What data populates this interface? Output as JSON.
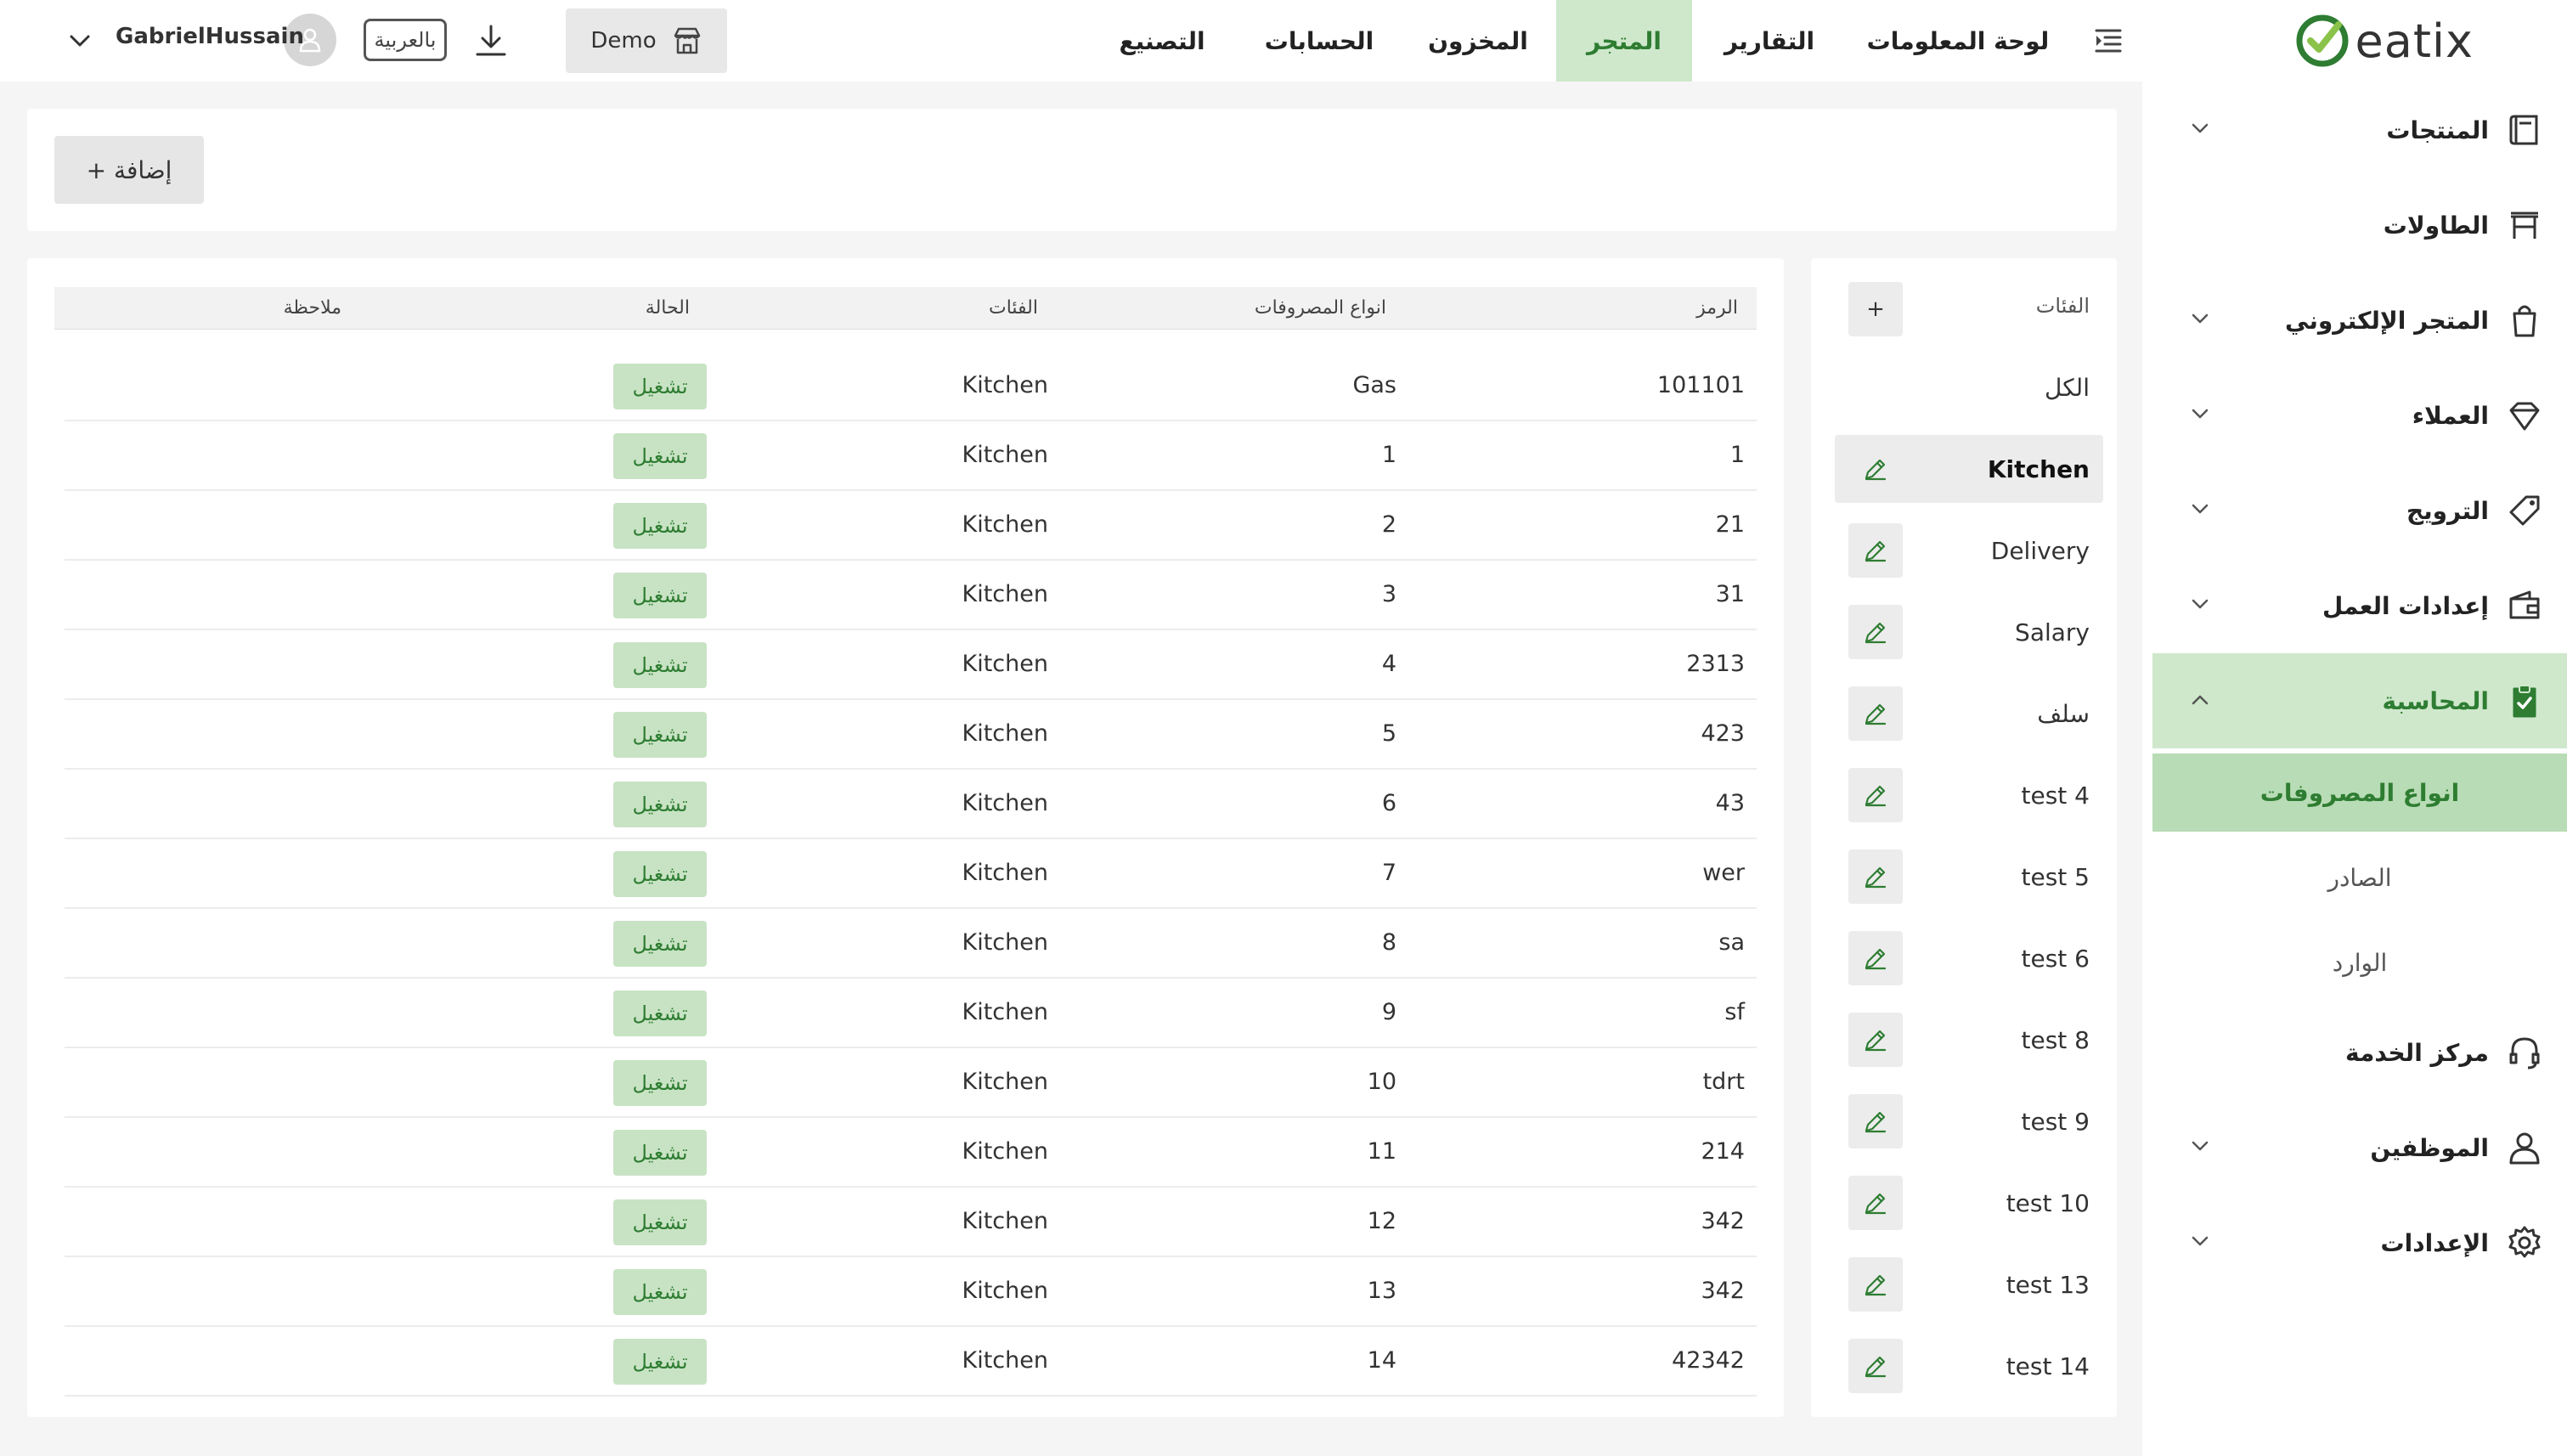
{
  "brand": {
    "name": "eatix",
    "accent": "#2e7d32",
    "accent_light": "#cfe8cc"
  },
  "topbar": {
    "tabs": [
      {
        "label": "لوحة المعلومات"
      },
      {
        "label": "التقارير"
      },
      {
        "label": "المتجر",
        "active": true
      },
      {
        "label": "المخزون"
      },
      {
        "label": "الحسابات"
      },
      {
        "label": "التصنيع"
      }
    ],
    "store_label": "Demo",
    "language_label": "بالعربية",
    "user_name": "GabrielHussain"
  },
  "sidebar": {
    "items": [
      {
        "label": "المنتجات",
        "icon": "book-icon",
        "chevron": "down"
      },
      {
        "label": "الطاولات",
        "icon": "table-icon",
        "chevron": ""
      },
      {
        "label": "المتجر الإلكتروني",
        "icon": "shopping-bag-icon",
        "chevron": "down"
      },
      {
        "label": "العملاء",
        "icon": "diamond-icon",
        "chevron": "down"
      },
      {
        "label": "الترويج",
        "icon": "tag-icon",
        "chevron": "down"
      },
      {
        "label": "إعدادات العمل",
        "icon": "wallet-icon",
        "chevron": "down"
      },
      {
        "label": "المحاسبة",
        "icon": "clipboard-check-icon",
        "chevron": "up",
        "active": true
      },
      {
        "label": "مركز الخدمة",
        "icon": "headset-icon",
        "chevron": ""
      },
      {
        "label": "الموظفين",
        "icon": "user-icon",
        "chevron": "down"
      },
      {
        "label": "الإعدادات",
        "icon": "gear-icon",
        "chevron": "down"
      }
    ],
    "subitems": [
      {
        "label": "انواع المصروفات",
        "active": true
      },
      {
        "label": "الصادر"
      },
      {
        "label": "الوارد"
      }
    ]
  },
  "actions": {
    "add_label": "+ إضافة"
  },
  "categories": {
    "header": "الفئات",
    "add_label": "+",
    "items": [
      {
        "name": "الكل",
        "editable": false
      },
      {
        "name": "Kitchen",
        "editable": true,
        "active": true
      },
      {
        "name": "Delivery",
        "editable": true
      },
      {
        "name": "Salary",
        "editable": true
      },
      {
        "name": "سلف",
        "editable": true
      },
      {
        "name": "test 4",
        "editable": true
      },
      {
        "name": "test 5",
        "editable": true
      },
      {
        "name": "test 6",
        "editable": true
      },
      {
        "name": "test 8",
        "editable": true
      },
      {
        "name": "test 9",
        "editable": true
      },
      {
        "name": "test 10",
        "editable": true
      },
      {
        "name": "test 13",
        "editable": true
      },
      {
        "name": "test 14",
        "editable": true
      }
    ]
  },
  "table": {
    "columns": {
      "code": "الرمز",
      "type": "انواع المصروفات",
      "category": "الفئات",
      "status": "الحالة",
      "note": "ملاحظة"
    },
    "rows": [
      {
        "code": "101101",
        "type": "Gas",
        "category": "Kitchen",
        "status": "تشغيل",
        "note": ""
      },
      {
        "code": "1",
        "type": "1",
        "category": "Kitchen",
        "status": "تشغيل",
        "note": ""
      },
      {
        "code": "21",
        "type": "2",
        "category": "Kitchen",
        "status": "تشغيل",
        "note": ""
      },
      {
        "code": "31",
        "type": "3",
        "category": "Kitchen",
        "status": "تشغيل",
        "note": ""
      },
      {
        "code": "2313",
        "type": "4",
        "category": "Kitchen",
        "status": "تشغيل",
        "note": ""
      },
      {
        "code": "423",
        "type": "5",
        "category": "Kitchen",
        "status": "تشغيل",
        "note": ""
      },
      {
        "code": "43",
        "type": "6",
        "category": "Kitchen",
        "status": "تشغيل",
        "note": ""
      },
      {
        "code": "wer",
        "type": "7",
        "category": "Kitchen",
        "status": "تشغيل",
        "note": ""
      },
      {
        "code": "sa",
        "type": "8",
        "category": "Kitchen",
        "status": "تشغيل",
        "note": ""
      },
      {
        "code": "sf",
        "type": "9",
        "category": "Kitchen",
        "status": "تشغيل",
        "note": ""
      },
      {
        "code": "tdrt",
        "type": "10",
        "category": "Kitchen",
        "status": "تشغيل",
        "note": ""
      },
      {
        "code": "214",
        "type": "11",
        "category": "Kitchen",
        "status": "تشغيل",
        "note": ""
      },
      {
        "code": "342",
        "type": "12",
        "category": "Kitchen",
        "status": "تشغيل",
        "note": ""
      },
      {
        "code": "342",
        "type": "13",
        "category": "Kitchen",
        "status": "تشغيل",
        "note": ""
      },
      {
        "code": "42342",
        "type": "14",
        "category": "Kitchen",
        "status": "تشغيل",
        "note": ""
      }
    ]
  }
}
